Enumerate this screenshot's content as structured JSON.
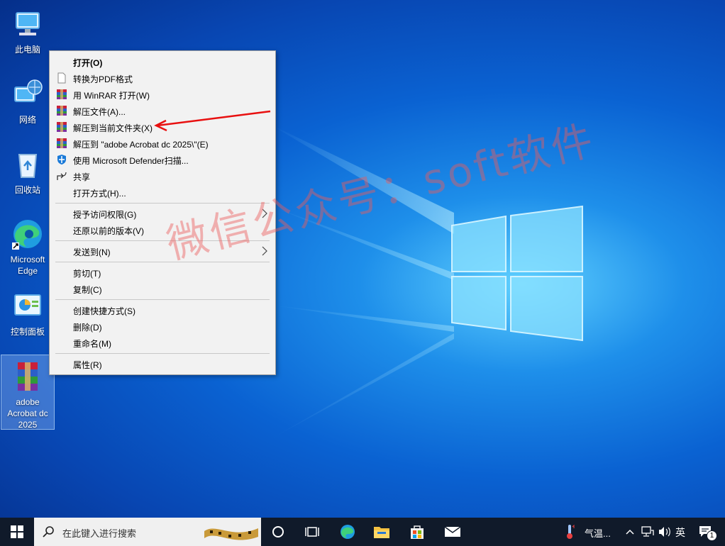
{
  "desktop": {
    "icons": [
      {
        "name": "此电脑",
        "icon": "computer-icon"
      },
      {
        "name": "网络",
        "icon": "network-icon"
      },
      {
        "name": "回收站",
        "icon": "recycle-bin-icon"
      },
      {
        "name": "Microsoft Edge",
        "icon": "edge-icon"
      },
      {
        "name": "控制面板",
        "icon": "control-panel-icon"
      },
      {
        "name": "adobe Acrobat dc 2025",
        "icon": "winrar-archive-icon"
      }
    ]
  },
  "context_menu": {
    "items": [
      {
        "label": "打开(O)",
        "icon": "",
        "bold": true
      },
      {
        "label": "转换为PDF格式",
        "icon": "document-icon"
      },
      {
        "label": "用 WinRAR 打开(W)",
        "icon": "winrar-icon"
      },
      {
        "label": "解压文件(A)...",
        "icon": "winrar-icon"
      },
      {
        "label": "解压到当前文件夹(X)",
        "icon": "winrar-icon"
      },
      {
        "label": "解压到 \"adobe Acrobat dc 2025\\\"(E)",
        "icon": "winrar-icon"
      },
      {
        "label": "使用 Microsoft Defender扫描...",
        "icon": "defender-shield-icon"
      },
      {
        "label": "共享",
        "icon": "share-icon"
      },
      {
        "label": "打开方式(H)...",
        "icon": ""
      },
      {
        "label": "授予访问权限(G)",
        "icon": "",
        "submenu": true
      },
      {
        "label": "还原以前的版本(V)",
        "icon": ""
      },
      {
        "label": "发送到(N)",
        "icon": "",
        "submenu": true
      },
      {
        "label": "剪切(T)",
        "icon": ""
      },
      {
        "label": "复制(C)",
        "icon": ""
      },
      {
        "label": "创建快捷方式(S)",
        "icon": ""
      },
      {
        "label": "删除(D)",
        "icon": ""
      },
      {
        "label": "重命名(M)",
        "icon": ""
      },
      {
        "label": "属性(R)",
        "icon": ""
      }
    ]
  },
  "annotation": {
    "arrow_target": "解压到当前文件夹(X)",
    "color": "#e81010"
  },
  "watermark": "微信公众号：soft软件",
  "taskbar": {
    "search_placeholder": "在此键入进行搜索",
    "weather_text": "气温...",
    "ime": "英",
    "notification_count": "1",
    "colors": {
      "bar": "#101a2a",
      "search": "#f0f0f0"
    }
  }
}
